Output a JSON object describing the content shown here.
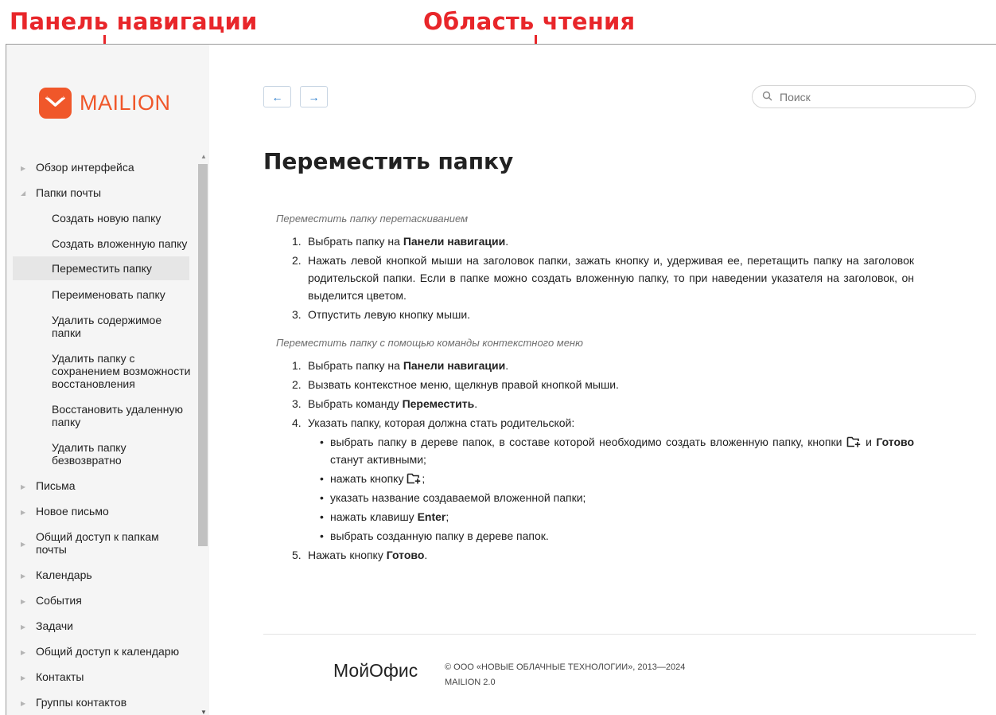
{
  "annotations": {
    "nav_label": "Панель навигации",
    "read_label": "Область чтения"
  },
  "logo": {
    "text": "MAILION",
    "icon": "envelope-icon",
    "color": "#f0572a"
  },
  "sidebar": {
    "items": [
      {
        "label": "Обзор интерфейса",
        "level": 1,
        "state": "closed"
      },
      {
        "label": "Папки почты",
        "level": 1,
        "state": "open"
      },
      {
        "label": "Создать новую папку",
        "level": 2
      },
      {
        "label": "Создать вложенную папку",
        "level": 2
      },
      {
        "label": "Переместить папку",
        "level": 2,
        "active": true
      },
      {
        "label": "Переименовать папку",
        "level": 2
      },
      {
        "label": "Удалить содержимое папки",
        "level": 2
      },
      {
        "label": "Удалить папку с сохранением возможности восстановления",
        "level": 2
      },
      {
        "label": "Восстановить удаленную папку",
        "level": 2
      },
      {
        "label": "Удалить папку безвозвратно",
        "level": 2
      },
      {
        "label": "Письма",
        "level": 1,
        "state": "closed"
      },
      {
        "label": "Новое письмо",
        "level": 1,
        "state": "closed"
      },
      {
        "label": "Общий доступ к папкам почты",
        "level": 1,
        "state": "closed"
      },
      {
        "label": "Календарь",
        "level": 1,
        "state": "closed"
      },
      {
        "label": "События",
        "level": 1,
        "state": "closed"
      },
      {
        "label": "Задачи",
        "level": 1,
        "state": "closed"
      },
      {
        "label": "Общий доступ к календарю",
        "level": 1,
        "state": "closed"
      },
      {
        "label": "Контакты",
        "level": 1,
        "state": "closed"
      },
      {
        "label": "Группы контактов",
        "level": 1,
        "state": "closed"
      }
    ]
  },
  "toolbar": {
    "back_label": "←",
    "forward_label": "→",
    "search_placeholder": "Поиск"
  },
  "article": {
    "title": "Переместить папку",
    "section1": {
      "heading": "Переместить папку перетаскиванием",
      "steps": [
        {
          "num": "1.",
          "pre": "Выбрать папку на ",
          "bold": "Панели навигации",
          "post": "."
        },
        {
          "num": "2.",
          "text": "Нажать левой кнопкой мыши на заголовок папки, зажать кнопку и, удерживая ее, перетащить папку на заголовок родительской папки. Если в папке можно создать вложенную папку, то при наведении указателя на заголовок, он выделится цветом."
        },
        {
          "num": "3.",
          "text": "Отпустить левую кнопку мыши."
        }
      ]
    },
    "section2": {
      "heading": "Переместить папку с помощью команды контекстного меню",
      "step1": {
        "num": "1.",
        "pre": "Выбрать папку на ",
        "bold": "Панели навигации",
        "post": "."
      },
      "step2": {
        "num": "2.",
        "text": "Вызвать контекстное меню, щелкнув правой кнопкой мыши."
      },
      "step3": {
        "num": "3.",
        "pre": "Выбрать команду ",
        "bold": "Переместить",
        "post": "."
      },
      "step4": {
        "num": "4.",
        "text": "Указать папку, которая должна стать родительской:",
        "sub1": {
          "pre": "выбрать папку в дереве папок, в составе которой необходимо создать вложенную папку, кнопки ",
          "mid": " и ",
          "bold": "Готово",
          "post": " станут активными;"
        },
        "sub2": {
          "pre": "нажать кнопку ",
          "post": ";"
        },
        "sub3": {
          "text": "указать название создаваемой вложенной папки;"
        },
        "sub4": {
          "pre": "нажать клавишу ",
          "bold": "Enter",
          "post": ";"
        },
        "sub5": {
          "text": "выбрать созданную папку в дереве папок."
        }
      },
      "step5": {
        "num": "5.",
        "pre": "Нажать кнопку ",
        "bold": "Готово",
        "post": "."
      }
    }
  },
  "footer": {
    "brand": "МойОфис",
    "copyright": "© ООО «НОВЫЕ ОБЛАЧНЫЕ ТЕХНОЛОГИИ», 2013—2024",
    "version": "MAILION 2.0"
  },
  "colors": {
    "accent": "#f0572a",
    "annotation": "#e8262a",
    "link_blue": "#1a73c8"
  }
}
